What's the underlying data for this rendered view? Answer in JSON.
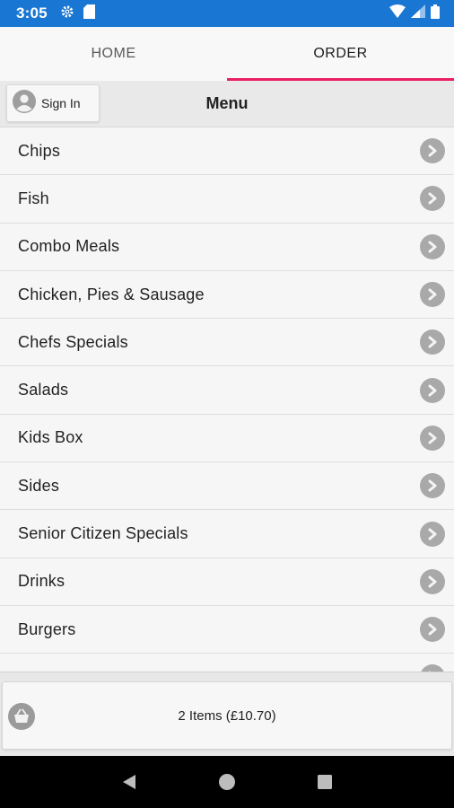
{
  "status_bar": {
    "time": "3:05",
    "icons": [
      "gear-icon",
      "sd-card-icon",
      "wifi-icon",
      "signal-icon",
      "battery-icon"
    ]
  },
  "tabs": [
    {
      "label": "HOME",
      "active": false
    },
    {
      "label": "ORDER",
      "active": true
    }
  ],
  "header": {
    "sign_in_label": "Sign In",
    "title": "Menu"
  },
  "menu": {
    "items": [
      {
        "label": "Chips"
      },
      {
        "label": "Fish"
      },
      {
        "label": "Combo Meals"
      },
      {
        "label": "Chicken, Pies & Sausage"
      },
      {
        "label": "Chefs Specials"
      },
      {
        "label": "Salads"
      },
      {
        "label": "Kids Box"
      },
      {
        "label": "Sides"
      },
      {
        "label": "Senior Citizen Specials"
      },
      {
        "label": "Drinks"
      },
      {
        "label": "Burgers"
      },
      {
        "label": ""
      }
    ]
  },
  "cart": {
    "summary": "2 Items (£10.70)"
  },
  "colors": {
    "status_bar": "#1976d2",
    "active_tab_indicator": "#e91e63",
    "chevron_bg": "#a9a9a9"
  }
}
